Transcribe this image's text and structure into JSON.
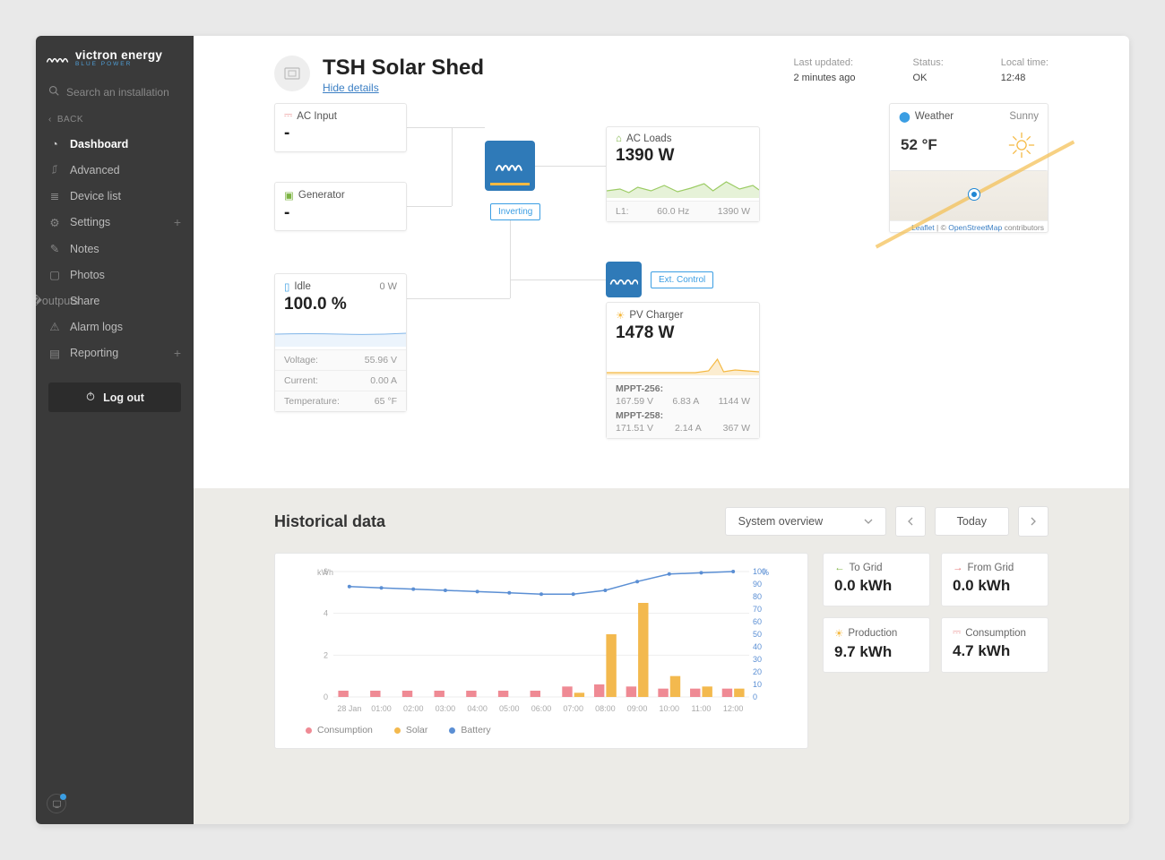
{
  "brand": {
    "name": "victron energy",
    "sub": "BLUE POWER"
  },
  "search": {
    "placeholder": "Search an installation"
  },
  "back_label": "BACK",
  "nav": {
    "dashboard": "Dashboard",
    "advanced": "Advanced",
    "device_list": "Device list",
    "settings": "Settings",
    "notes": "Notes",
    "photos": "Photos",
    "share": "Share",
    "alarm_logs": "Alarm logs",
    "reporting": "Reporting"
  },
  "logout": "Log out",
  "header": {
    "title": "TSH Solar Shed",
    "hide_details": "Hide details",
    "last_updated_lbl": "Last updated:",
    "last_updated_val": "2 minutes ago",
    "status_lbl": "Status:",
    "status_val": "OK",
    "local_time_lbl": "Local time:",
    "local_time_val": "12:48"
  },
  "diagram": {
    "ac_input": {
      "label": "AC Input",
      "value": "-"
    },
    "generator": {
      "label": "Generator",
      "value": "-"
    },
    "inverting_tag": "Inverting",
    "ac_loads": {
      "label": "AC Loads",
      "value": "1390 W",
      "l1_lbl": "L1:",
      "hz": "60.0 Hz",
      "w": "1390 W"
    },
    "battery": {
      "label": "Idle",
      "wattage": "0 W",
      "percent": "100.0 %",
      "voltage_lbl": "Voltage:",
      "voltage": "55.96 V",
      "current_lbl": "Current:",
      "current": "0.00 A",
      "temp_lbl": "Temperature:",
      "temp": "65 °F"
    },
    "ext_control": "Ext. Control",
    "pv": {
      "label": "PV Charger",
      "value": "1478 W",
      "m1_name": "MPPT-256:",
      "m1_v": "167.59 V",
      "m1_a": "6.83 A",
      "m1_w": "1144 W",
      "m2_name": "MPPT-258:",
      "m2_v": "171.51 V",
      "m2_a": "2.14 A",
      "m2_w": "367 W"
    },
    "weather": {
      "label": "Weather",
      "cond": "Sunny",
      "temp": "52 °F"
    },
    "map": {
      "leaflet": "Leaflet",
      "osm": "OpenStreetMap",
      "tail": " contributors",
      "sep": " | © "
    }
  },
  "hist": {
    "title": "Historical data",
    "select": "System overview",
    "today": "Today",
    "ylabel": "kWh",
    "y2label": "%",
    "legend": {
      "consumption": "Consumption",
      "solar": "Solar",
      "battery": "Battery"
    },
    "stats": {
      "to_grid_lbl": "To Grid",
      "to_grid": "0.0 kWh",
      "from_grid_lbl": "From Grid",
      "from_grid": "0.0 kWh",
      "production_lbl": "Production",
      "production": "9.7 kWh",
      "consumption_lbl": "Consumption",
      "consumption": "4.7 kWh"
    }
  },
  "chart_data": {
    "type": "bar",
    "categories": [
      "28 Jan",
      "01:00",
      "02:00",
      "03:00",
      "04:00",
      "05:00",
      "06:00",
      "07:00",
      "08:00",
      "09:00",
      "10:00",
      "11:00",
      "12:00"
    ],
    "series": [
      {
        "name": "Consumption",
        "values": [
          0.3,
          0.3,
          0.3,
          0.3,
          0.3,
          0.3,
          0.3,
          0.5,
          0.6,
          0.5,
          0.4,
          0.4,
          0.4
        ],
        "color": "#ef8a94"
      },
      {
        "name": "Solar",
        "values": [
          0,
          0,
          0,
          0,
          0,
          0,
          0,
          0.2,
          3.0,
          4.5,
          1.0,
          0.5,
          0.4
        ],
        "color": "#f3b94e"
      },
      {
        "name": "Battery",
        "values": [
          88,
          87,
          86,
          85,
          84,
          83,
          82,
          82,
          85,
          92,
          98,
          99,
          100
        ],
        "color": "#5b8fd4",
        "y_axis": "right"
      }
    ],
    "ylabel": "kWh",
    "ylim": [
      0,
      6
    ],
    "y2label": "%",
    "y2lim": [
      0,
      100
    ]
  }
}
